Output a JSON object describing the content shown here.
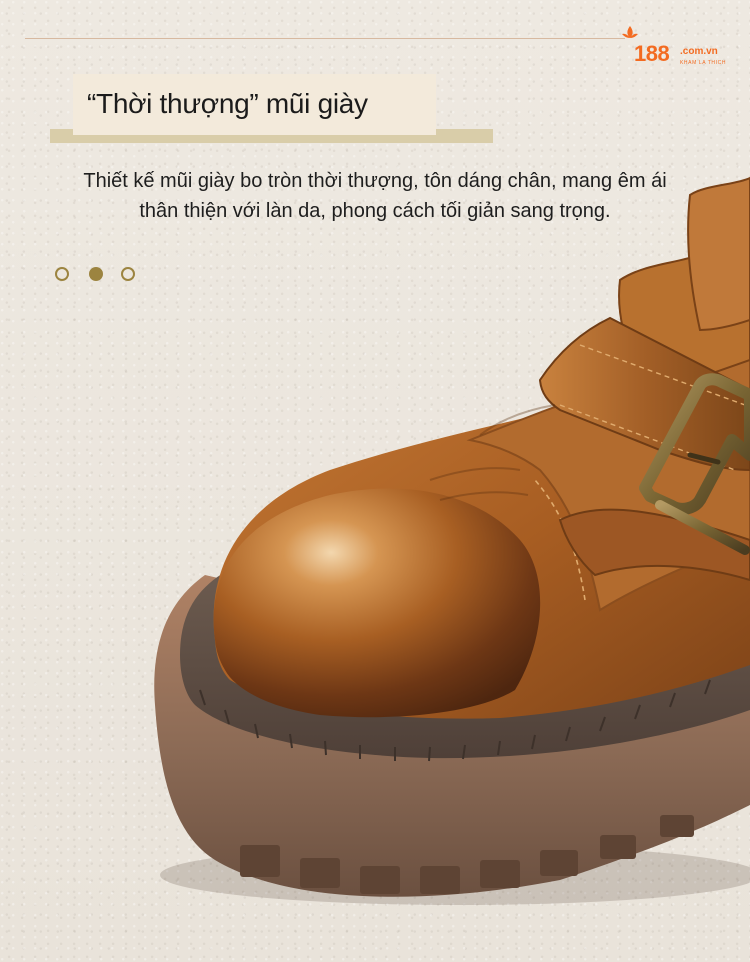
{
  "logo": {
    "brand": "188",
    "domain": ".com.vn",
    "tagline": "KHAM LA THICH",
    "accent": "#f36b21"
  },
  "title": "“Thời thượng” mũi giày",
  "description": {
    "line1": "Thiết kế mũi giày bo tròn thời thượng, tôn dáng chân, mang êm ái",
    "line2": "thân thiện với làn da, phong cách tối giản sang trọng."
  },
  "carousel": {
    "total": 3,
    "active_index": 2
  },
  "colors": {
    "background": "#ece7df",
    "title_box": "#f3eadb",
    "title_bar": "#d9cda9",
    "dot": "#9c8440",
    "leather": "#a85f23",
    "sole": "#8b6a55"
  }
}
